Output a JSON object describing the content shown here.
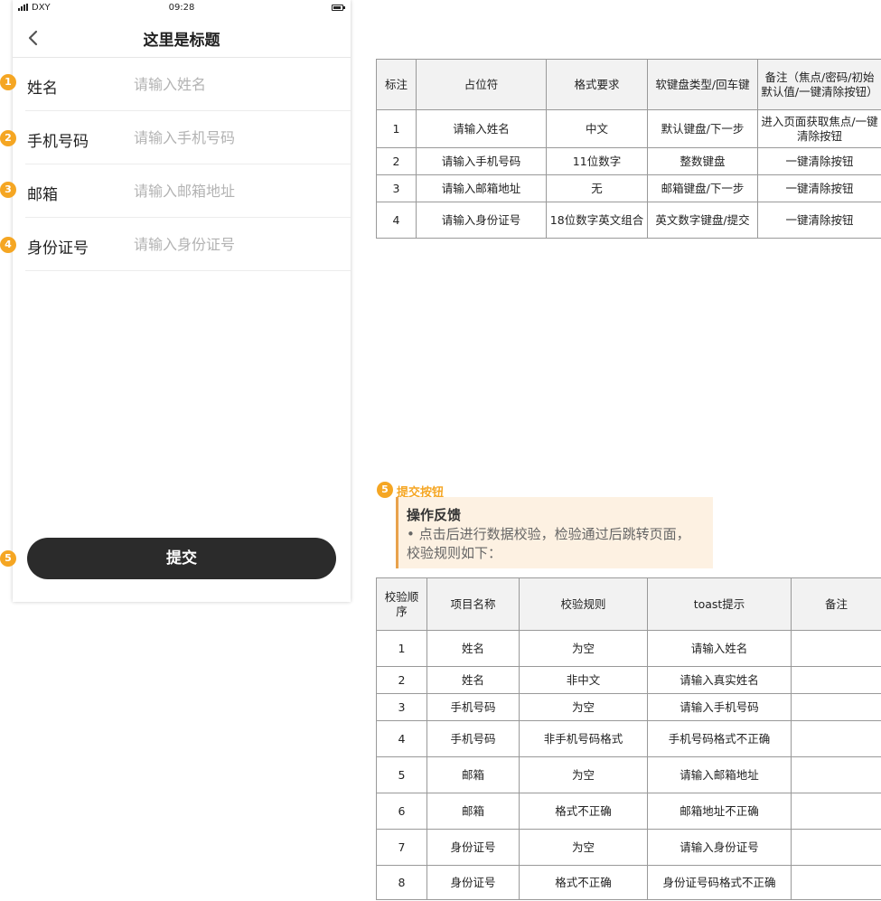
{
  "status_bar": {
    "carrier": "DXY",
    "time": "09:28"
  },
  "nav": {
    "title": "这里是标题"
  },
  "form": {
    "fields": [
      {
        "marker": "1",
        "label": "姓名",
        "placeholder": "请输入姓名"
      },
      {
        "marker": "2",
        "label": "手机号码",
        "placeholder": "请输入手机号码"
      },
      {
        "marker": "3",
        "label": "邮箱",
        "placeholder": "请输入邮箱地址"
      },
      {
        "marker": "4",
        "label": "身份证号",
        "placeholder": "请输入身份证号"
      }
    ],
    "submit": {
      "marker": "5",
      "label": "提交"
    }
  },
  "field_table": {
    "headers": [
      "标注",
      "占位符",
      "格式要求",
      "软键盘类型/回车键",
      "备注（焦点/密码/初始默认值/一键清除按钮）"
    ],
    "rows": [
      [
        "1",
        "请输入姓名",
        "中文",
        "默认键盘/下一步",
        "进入页面获取焦点/一键清除按钮"
      ],
      [
        "2",
        "请输入手机号码",
        "11位数字",
        "整数键盘",
        "一键清除按钮"
      ],
      [
        "3",
        "请输入邮箱地址",
        "无",
        "邮箱键盘/下一步",
        "一键清除按钮"
      ],
      [
        "4",
        "请输入身份证号",
        "18位数字英文组合",
        "英文数字键盘/提交",
        "一键清除按钮"
      ]
    ]
  },
  "annotation": {
    "marker": "5",
    "title": "提交按钮",
    "feedback_title": "操作反馈",
    "feedback_line1": "• 点击后进行数据校验，检验通过后跳转页面，",
    "feedback_line2": "校验规则如下："
  },
  "validation_table": {
    "headers": [
      "校验顺序",
      "项目名称",
      "校验规则",
      "toast提示",
      "备注"
    ],
    "rows": [
      [
        "1",
        "姓名",
        "为空",
        "请输入姓名",
        ""
      ],
      [
        "2",
        "姓名",
        "非中文",
        "请输入真实姓名",
        ""
      ],
      [
        "3",
        "手机号码",
        "为空",
        "请输入手机号码",
        ""
      ],
      [
        "4",
        "手机号码",
        "非手机号码格式",
        "手机号码格式不正确",
        ""
      ],
      [
        "5",
        "邮箱",
        "为空",
        "请输入邮箱地址",
        ""
      ],
      [
        "6",
        "邮箱",
        "格式不正确",
        "邮箱地址不正确",
        ""
      ],
      [
        "7",
        "身份证号",
        "为空",
        "请输入身份证号",
        ""
      ],
      [
        "8",
        "身份证号",
        "格式不正确",
        "身份证号码格式不正确",
        ""
      ]
    ]
  },
  "colors": {
    "marker": "#f5a623",
    "button": "#2b2b2b",
    "feedback_bg": "#fdf1e2"
  }
}
